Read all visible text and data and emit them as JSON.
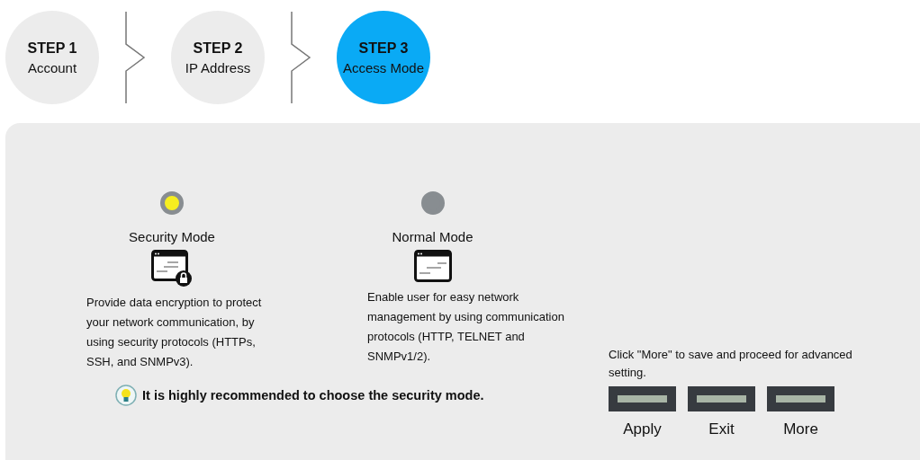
{
  "steps": [
    {
      "number": "STEP 1",
      "label": "Account",
      "selected": false
    },
    {
      "number": "STEP 2",
      "label": "IP Address",
      "selected": false
    },
    {
      "number": "STEP 3",
      "label": "Access Mode",
      "selected": true
    }
  ],
  "modes": [
    {
      "kind": "secure",
      "title": "Security Mode",
      "description": "Provide data encryption to protect your network communication, by using security protocols (HTTPs, SSH, and SNMPv3).",
      "selected": true
    },
    {
      "kind": "plain",
      "title": "Normal Mode",
      "description": "Enable user for easy network management by using communication protocols (HTTP, TELNET and SNMPv1/2).",
      "selected": false
    }
  ],
  "tip": "It is highly recommended to choose the security mode.",
  "note": "Click \"More\" to save and proceed for advanced setting.",
  "buttons": [
    {
      "label": "Apply"
    },
    {
      "label": "Exit"
    },
    {
      "label": "More"
    }
  ]
}
